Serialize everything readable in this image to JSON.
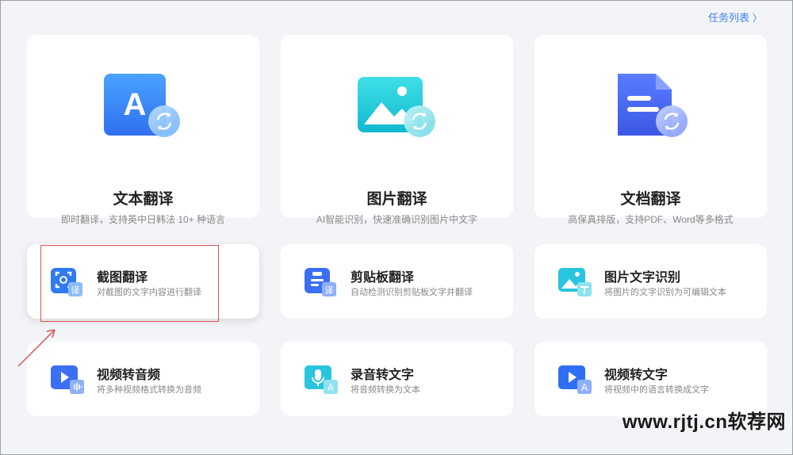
{
  "header": {
    "task_list_label": "任务列表"
  },
  "big_cards": [
    {
      "title": "文本翻译",
      "subtitle": "即时翻译，支持英中日韩法 10+ 种语言",
      "icon": "text-translate-icon"
    },
    {
      "title": "图片翻译",
      "subtitle": "AI智能识别，快速准确识别图片中文字",
      "icon": "image-translate-icon"
    },
    {
      "title": "文档翻译",
      "subtitle": "高保真排版，支持PDF、Word等多格式",
      "icon": "document-translate-icon"
    }
  ],
  "small_cards": [
    {
      "title": "截图翻译",
      "subtitle": "对截图的文字内容进行翻译",
      "icon": "screenshot-translate-icon",
      "badge": "译"
    },
    {
      "title": "剪贴板翻译",
      "subtitle": "自动检测识别剪贴板文字并翻译",
      "icon": "clipboard-translate-icon",
      "badge": "译"
    },
    {
      "title": "图片文字识别",
      "subtitle": "将图片的文字识别为可编辑文本",
      "icon": "image-ocr-icon"
    },
    {
      "title": "视频转音频",
      "subtitle": "将多种视频格式转换为音频",
      "icon": "video-to-audio-icon"
    },
    {
      "title": "录音转文字",
      "subtitle": "将音频转换为文本",
      "icon": "audio-to-text-icon",
      "badge": "A"
    },
    {
      "title": "视频转文字",
      "subtitle": "将视频中的语言转换成文字",
      "icon": "video-to-text-icon",
      "badge": "A"
    }
  ],
  "big_icon_letter": "A",
  "watermark": "www.rjtj.cn软荐网",
  "colors": {
    "accent": "#3f7ff5",
    "highlight": "#d9534f",
    "card": "#ffffff",
    "background": "#f3f4f7"
  }
}
